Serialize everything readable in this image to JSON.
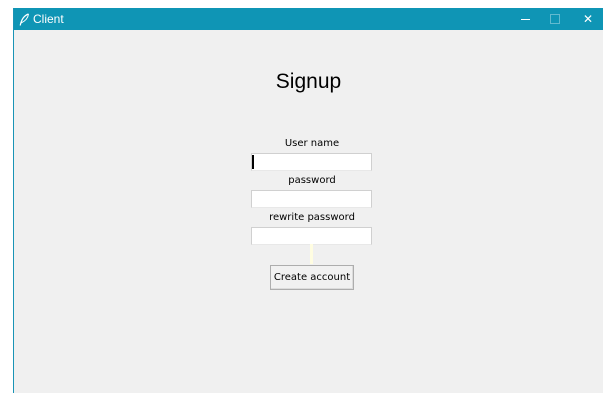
{
  "window": {
    "title": "Client",
    "icon": "feather-icon",
    "controls": {
      "minimize": "–",
      "maximize": "□",
      "close": "✕"
    }
  },
  "form": {
    "heading": "Signup",
    "username_label": "User name",
    "username_value": "",
    "password_label": "password",
    "password_value": "",
    "rewrite_label": "rewrite password",
    "rewrite_value": "",
    "submit_label": "Create account"
  },
  "colors": {
    "titlebar": "#0f95b5",
    "window_bg": "#f0f0f0",
    "status_bg": "#fffde1"
  }
}
